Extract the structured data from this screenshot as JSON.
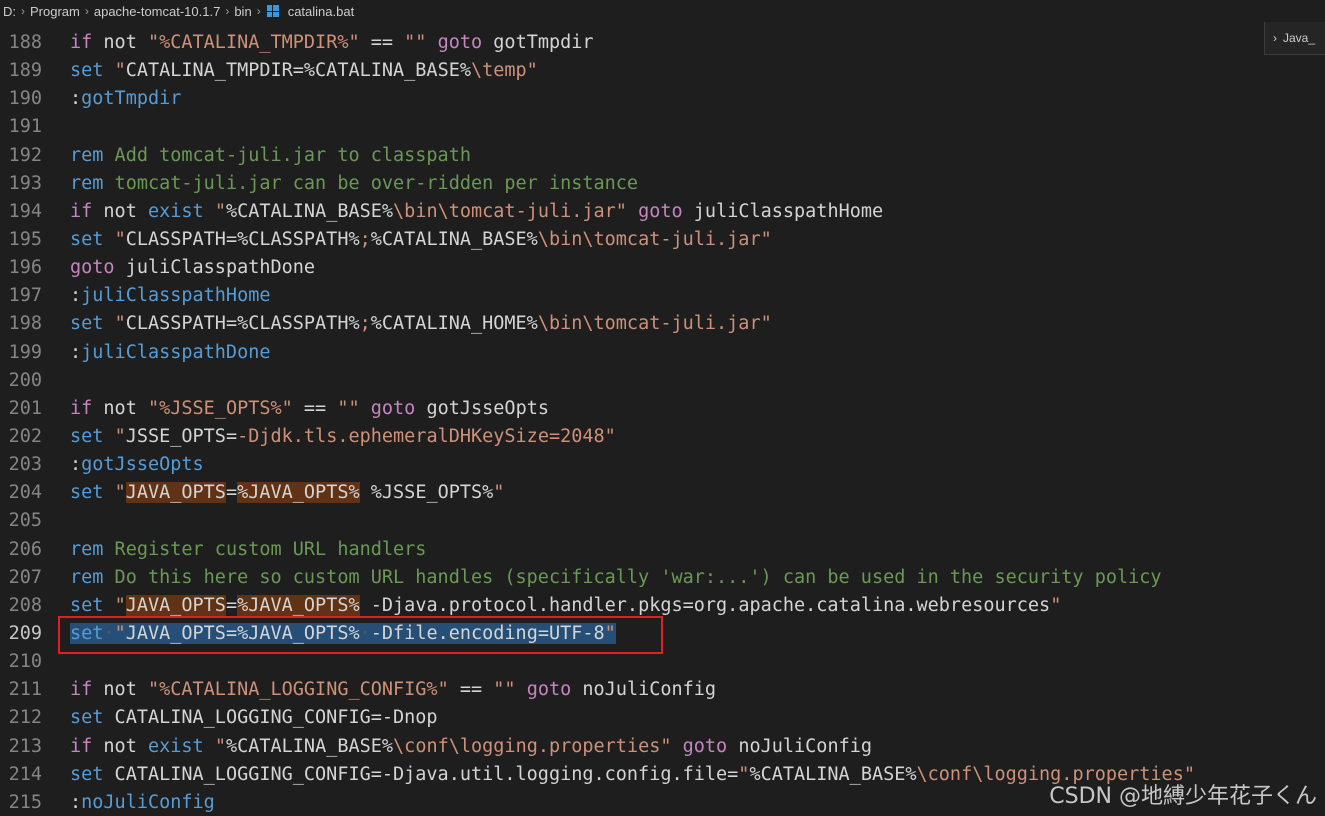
{
  "breadcrumb": {
    "items": [
      "D:",
      "Program",
      "apache-tomcat-10.1.7",
      "bin",
      "catalina.bat"
    ]
  },
  "outline_tab": {
    "label": "Java_"
  },
  "watermark": "CSDN @地縛少年花子くん",
  "highlight_colors": {
    "selection": "#264f78",
    "word_highlight": "#613214",
    "annotation_box": "#e02020"
  },
  "lines": [
    {
      "n": "188",
      "segments": [
        [
          "kw",
          "if"
        ],
        [
          "fg",
          " not "
        ],
        [
          "str",
          "\"%CATALINA_TMPDIR%\""
        ],
        [
          "fg",
          " == "
        ],
        [
          "str",
          "\"\""
        ],
        [
          "fg",
          " "
        ],
        [
          "kw",
          "goto"
        ],
        [
          "fg",
          " gotTmpdir"
        ]
      ]
    },
    {
      "n": "189",
      "segments": [
        [
          "kw2",
          "set"
        ],
        [
          "fg",
          " "
        ],
        [
          "str",
          "\""
        ],
        [
          "fg",
          "CATALINA_TMPDIR=%CATALINA_BASE%"
        ],
        [
          "str",
          "\\temp\""
        ]
      ]
    },
    {
      "n": "190",
      "segments": [
        [
          "fg",
          ":"
        ],
        [
          "lbl",
          "gotTmpdir"
        ]
      ]
    },
    {
      "n": "191",
      "segments": []
    },
    {
      "n": "192",
      "segments": [
        [
          "kw2",
          "rem"
        ],
        [
          "cm",
          " Add tomcat-juli.jar to classpath"
        ]
      ]
    },
    {
      "n": "193",
      "segments": [
        [
          "kw2",
          "rem"
        ],
        [
          "cm",
          " tomcat-juli.jar can be over-ridden per instance"
        ]
      ]
    },
    {
      "n": "194",
      "segments": [
        [
          "kw",
          "if"
        ],
        [
          "fg",
          " not "
        ],
        [
          "kw2",
          "exist"
        ],
        [
          "fg",
          " "
        ],
        [
          "str",
          "\""
        ],
        [
          "fg",
          "%CATALINA_BASE%"
        ],
        [
          "str",
          "\\bin\\tomcat-juli.jar\""
        ],
        [
          "fg",
          " "
        ],
        [
          "kw",
          "goto"
        ],
        [
          "fg",
          " juliClasspathHome"
        ]
      ]
    },
    {
      "n": "195",
      "segments": [
        [
          "kw2",
          "set"
        ],
        [
          "fg",
          " "
        ],
        [
          "str",
          "\""
        ],
        [
          "fg",
          "CLASSPATH=%CLASSPATH%"
        ],
        [
          "str",
          ";"
        ],
        [
          "fg",
          "%CATALINA_BASE%"
        ],
        [
          "str",
          "\\bin\\tomcat-juli.jar\""
        ]
      ]
    },
    {
      "n": "196",
      "segments": [
        [
          "kw",
          "goto"
        ],
        [
          "fg",
          " juliClasspathDone"
        ]
      ]
    },
    {
      "n": "197",
      "segments": [
        [
          "fg",
          ":"
        ],
        [
          "lbl",
          "juliClasspathHome"
        ]
      ]
    },
    {
      "n": "198",
      "segments": [
        [
          "kw2",
          "set"
        ],
        [
          "fg",
          " "
        ],
        [
          "str",
          "\""
        ],
        [
          "fg",
          "CLASSPATH=%CLASSPATH%"
        ],
        [
          "str",
          ";"
        ],
        [
          "fg",
          "%CATALINA_HOME%"
        ],
        [
          "str",
          "\\bin\\tomcat-juli.jar\""
        ]
      ]
    },
    {
      "n": "199",
      "segments": [
        [
          "fg",
          ":"
        ],
        [
          "lbl",
          "juliClasspathDone"
        ]
      ]
    },
    {
      "n": "200",
      "segments": []
    },
    {
      "n": "201",
      "segments": [
        [
          "kw",
          "if"
        ],
        [
          "fg",
          " not "
        ],
        [
          "str",
          "\"%JSSE_OPTS%\""
        ],
        [
          "fg",
          " == "
        ],
        [
          "str",
          "\"\""
        ],
        [
          "fg",
          " "
        ],
        [
          "kw",
          "goto"
        ],
        [
          "fg",
          " gotJsseOpts"
        ]
      ]
    },
    {
      "n": "202",
      "segments": [
        [
          "kw2",
          "set"
        ],
        [
          "fg",
          " "
        ],
        [
          "str",
          "\""
        ],
        [
          "fg",
          "JSSE_OPTS="
        ],
        [
          "str",
          "-Djdk.tls.ephemeralDHKeySize=2048\""
        ]
      ]
    },
    {
      "n": "203",
      "segments": [
        [
          "fg",
          ":"
        ],
        [
          "lbl",
          "gotJsseOpts"
        ]
      ]
    },
    {
      "n": "204",
      "segments": [
        [
          "kw2",
          "set"
        ],
        [
          "fg",
          " "
        ],
        [
          "str",
          "\""
        ],
        [
          "fghl",
          "JAVA_OPTS"
        ],
        [
          "fg",
          "="
        ],
        [
          "fghl",
          "%JAVA_OPTS%"
        ],
        [
          "fg",
          " %JSSE_OPTS%"
        ],
        [
          "str",
          "\""
        ]
      ]
    },
    {
      "n": "205",
      "segments": []
    },
    {
      "n": "206",
      "segments": [
        [
          "kw2",
          "rem"
        ],
        [
          "cm",
          " Register custom URL handlers"
        ]
      ]
    },
    {
      "n": "207",
      "segments": [
        [
          "kw2",
          "rem"
        ],
        [
          "cm",
          " Do this here so custom URL handles (specifically 'war:...') can be used in the security policy"
        ]
      ]
    },
    {
      "n": "208",
      "segments": [
        [
          "kw2",
          "set"
        ],
        [
          "fg",
          " "
        ],
        [
          "str",
          "\""
        ],
        [
          "fghl",
          "JAVA_OPTS"
        ],
        [
          "fg",
          "="
        ],
        [
          "fghl",
          "%JAVA_OPTS%"
        ],
        [
          "fg",
          " -Djava.protocol.handler.pkgs=org.apache.catalina.webresources"
        ],
        [
          "str",
          "\""
        ]
      ]
    },
    {
      "n": "209",
      "active": true,
      "segments": [
        [
          "selkw2",
          "set"
        ],
        [
          "selws",
          "·"
        ],
        [
          "selstr",
          "\""
        ],
        [
          "selhl",
          "JAVA_OPTS"
        ],
        [
          "selfg",
          "="
        ],
        [
          "selhl",
          "%JAVA_OPTS%"
        ],
        [
          "selws",
          "·"
        ],
        [
          "selfg",
          "-Dfile.encoding=UTF-8"
        ],
        [
          "selstr",
          "\""
        ]
      ]
    },
    {
      "n": "210",
      "segments": []
    },
    {
      "n": "211",
      "segments": [
        [
          "kw",
          "if"
        ],
        [
          "fg",
          " not "
        ],
        [
          "str",
          "\"%CATALINA_LOGGING_CONFIG%\""
        ],
        [
          "fg",
          " == "
        ],
        [
          "str",
          "\"\""
        ],
        [
          "fg",
          " "
        ],
        [
          "kw",
          "goto"
        ],
        [
          "fg",
          " noJuliConfig"
        ]
      ]
    },
    {
      "n": "212",
      "segments": [
        [
          "kw2",
          "set"
        ],
        [
          "fg",
          " CATALINA_LOGGING_CONFIG=-Dnop"
        ]
      ]
    },
    {
      "n": "213",
      "segments": [
        [
          "kw",
          "if"
        ],
        [
          "fg",
          " not "
        ],
        [
          "kw2",
          "exist"
        ],
        [
          "fg",
          " "
        ],
        [
          "str",
          "\""
        ],
        [
          "fg",
          "%CATALINA_BASE%"
        ],
        [
          "str",
          "\\conf\\logging.properties\""
        ],
        [
          "fg",
          " "
        ],
        [
          "kw",
          "goto"
        ],
        [
          "fg",
          " noJuliConfig"
        ]
      ]
    },
    {
      "n": "214",
      "segments": [
        [
          "kw2",
          "set"
        ],
        [
          "fg",
          " CATALINA_LOGGING_CONFIG=-Djava.util.logging.config.file="
        ],
        [
          "str",
          "\""
        ],
        [
          "fg",
          "%CATALINA_BASE%"
        ],
        [
          "str",
          "\\conf\\logging.properties\""
        ]
      ]
    },
    {
      "n": "215",
      "segments": [
        [
          "fg",
          ":"
        ],
        [
          "lbl",
          "noJuliConfig"
        ]
      ]
    }
  ]
}
